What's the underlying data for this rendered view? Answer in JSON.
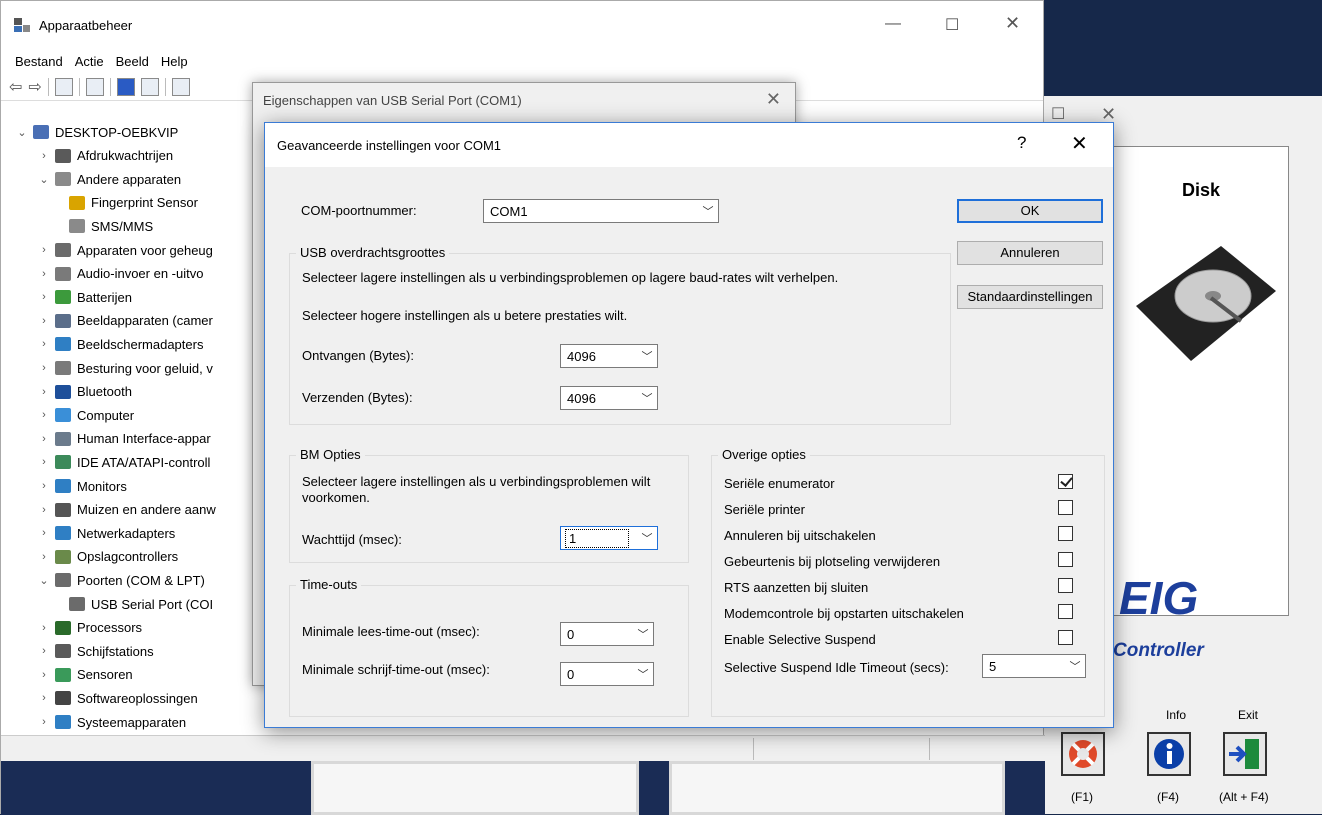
{
  "feig": {
    "disk_title": "Disk",
    "logo_text": "EIG",
    "controller_text": "Controller",
    "buttons": [
      {
        "label": "",
        "key": "(F1)",
        "icon": "lifebuoy-icon"
      },
      {
        "label": "Info",
        "key": "(F4)",
        "icon": "info-icon"
      },
      {
        "label": "Exit",
        "key": "(Alt + F4)",
        "icon": "exit-door-icon"
      }
    ]
  },
  "devmgr": {
    "title": "Apparaatbeheer",
    "menu": [
      "Bestand",
      "Actie",
      "Beeld",
      "Help"
    ],
    "tree": [
      {
        "label": "DESKTOP-OEBKVIP",
        "expanded": true,
        "level": 0,
        "icon_color": "#4a6fb5"
      },
      {
        "label": "Afdrukwachtrijen",
        "expanded": false,
        "level": 1,
        "icon_color": "#5a5a5a"
      },
      {
        "label": "Andere apparaten",
        "expanded": true,
        "level": 1,
        "icon_color": "#8a8a8a"
      },
      {
        "label": "Fingerprint Sensor",
        "expanded": null,
        "level": 2,
        "icon_color": "#d9a400"
      },
      {
        "label": "SMS/MMS",
        "expanded": null,
        "level": 2,
        "icon_color": "#8a8a8a"
      },
      {
        "label": "Apparaten voor geheug",
        "expanded": false,
        "level": 1,
        "icon_color": "#6b6b6b"
      },
      {
        "label": "Audio-invoer en -uitvo",
        "expanded": false,
        "level": 1,
        "icon_color": "#7a7a7a"
      },
      {
        "label": "Batterijen",
        "expanded": false,
        "level": 1,
        "icon_color": "#3c9a3c"
      },
      {
        "label": "Beeldapparaten (camer",
        "expanded": false,
        "level": 1,
        "icon_color": "#5b6e8a"
      },
      {
        "label": "Beeldschermadapters",
        "expanded": false,
        "level": 1,
        "icon_color": "#2f7fc4"
      },
      {
        "label": "Besturing voor geluid, v",
        "expanded": false,
        "level": 1,
        "icon_color": "#7a7a7a"
      },
      {
        "label": "Bluetooth",
        "expanded": false,
        "level": 1,
        "icon_color": "#1e4f9a"
      },
      {
        "label": "Computer",
        "expanded": false,
        "level": 1,
        "icon_color": "#3a8fd8"
      },
      {
        "label": "Human Interface-appar",
        "expanded": false,
        "level": 1,
        "icon_color": "#6b7b8c"
      },
      {
        "label": "IDE ATA/ATAPI-controll",
        "expanded": false,
        "level": 1,
        "icon_color": "#3c8a5a"
      },
      {
        "label": "Monitors",
        "expanded": false,
        "level": 1,
        "icon_color": "#2f7fc4"
      },
      {
        "label": "Muizen en andere aanw",
        "expanded": false,
        "level": 1,
        "icon_color": "#555555"
      },
      {
        "label": "Netwerkadapters",
        "expanded": false,
        "level": 1,
        "icon_color": "#2f7fc4"
      },
      {
        "label": "Opslagcontrollers",
        "expanded": false,
        "level": 1,
        "icon_color": "#6a8a4a"
      },
      {
        "label": "Poorten (COM & LPT)",
        "expanded": true,
        "level": 1,
        "icon_color": "#6b6b6b"
      },
      {
        "label": "USB Serial Port (COI",
        "expanded": null,
        "level": 2,
        "icon_color": "#6b6b6b"
      },
      {
        "label": "Processors",
        "expanded": false,
        "level": 1,
        "icon_color": "#2a6a2a"
      },
      {
        "label": "Schijfstations",
        "expanded": false,
        "level": 1,
        "icon_color": "#5a5a5a"
      },
      {
        "label": "Sensoren",
        "expanded": false,
        "level": 1,
        "icon_color": "#3a9a5a"
      },
      {
        "label": "Softwareoplossingen",
        "expanded": false,
        "level": 1,
        "icon_color": "#444444"
      },
      {
        "label": "Systeemapparaten",
        "expanded": false,
        "level": 1,
        "icon_color": "#2f7fc4"
      }
    ]
  },
  "props": {
    "title": "Eigenschappen van USB Serial Port (COM1)"
  },
  "adv": {
    "title": "Geavanceerde instellingen voor COM1",
    "help": "?",
    "com_label": "COM-poortnummer:",
    "com_value": "COM1",
    "buttons": {
      "ok": "OK",
      "cancel": "Annuleren",
      "defaults": "Standaardinstellingen"
    },
    "usb": {
      "legend": "USB overdrachtsgroottes",
      "hint_low": "Selecteer lagere instellingen als u verbindingsproblemen op lagere baud-rates wilt verhelpen.",
      "hint_high": "Selecteer hogere instellingen als u betere prestaties wilt.",
      "receive_label": "Ontvangen (Bytes):",
      "receive_value": "4096",
      "send_label": "Verzenden (Bytes):",
      "send_value": "4096"
    },
    "bm": {
      "legend": "BM Opties",
      "hint": "Selecteer lagere instellingen als u verbindingsproblemen wilt voorkomen.",
      "latency_label": "Wachttijd (msec):",
      "latency_value": "1"
    },
    "timeouts": {
      "legend": "Time-outs",
      "read_label": "Minimale lees-time-out (msec):",
      "read_value": "0",
      "write_label": "Minimale schrijf-time-out (msec):",
      "write_value": "0"
    },
    "misc": {
      "legend": "Overige opties",
      "options": [
        {
          "label": "Seriële enumerator",
          "checked": true
        },
        {
          "label": "Seriële printer",
          "checked": false
        },
        {
          "label": "Annuleren bij uitschakelen",
          "checked": false
        },
        {
          "label": "Gebeurtenis bij plotseling verwijderen",
          "checked": false
        },
        {
          "label": "RTS aanzetten bij sluiten",
          "checked": false
        },
        {
          "label": "Modemcontrole bij opstarten uitschakelen",
          "checked": false
        },
        {
          "label": "Enable Selective Suspend",
          "checked": false
        }
      ],
      "idle_label": "Selective Suspend Idle Timeout (secs):",
      "idle_value": "5"
    }
  },
  "colors": {
    "accent": "#1e6fd9",
    "feig_blue": "#1d3f9c"
  }
}
